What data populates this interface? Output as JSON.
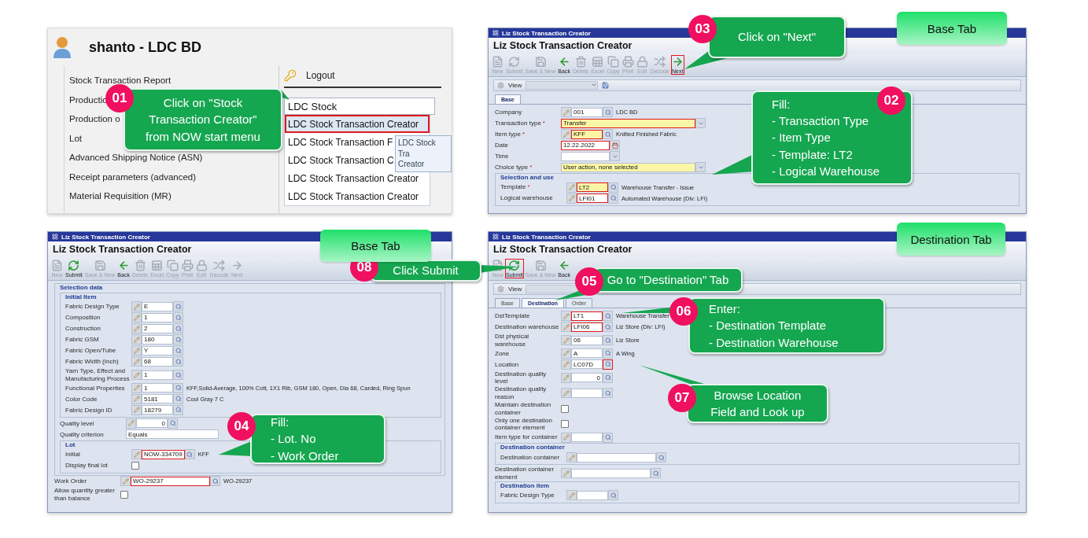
{
  "panels": [
    {
      "kind": "portal",
      "user": "shanto - LDC BD",
      "menu": [
        "Stock Transaction Report",
        "Productio",
        "Production o",
        "Lot",
        "Advanced Shipping Notice (ASN)",
        "Receipt parameters (advanced)",
        "Material Requisition (MR)"
      ],
      "logout": "Logout",
      "search": {
        "value": "LDC Stock"
      },
      "results": [
        {
          "label": "LDC Stock Transaction Creator",
          "selected": true
        },
        {
          "label": "LDC Stock Transaction F",
          "selected": false
        },
        {
          "label": "LDC Stock Transaction C",
          "selected": false
        },
        {
          "label": "LDC Stock Transaction Creator",
          "selected": false
        },
        {
          "label": "LDC Stock Transaction Creator",
          "selected": false
        }
      ],
      "tooltip": "LDC Stock Tra\nCreator"
    },
    {
      "kind": "form",
      "window_title": "Liz Stock Transaction Creator",
      "heading": "Liz Stock Transaction Creator",
      "toolbar": [
        {
          "label": "New",
          "enabled": false,
          "highlighted": false
        },
        {
          "label": "Submit",
          "enabled": false,
          "highlighted": false
        },
        {
          "label": "Save & New",
          "enabled": false,
          "highlighted": false
        },
        {
          "label": "Back",
          "enabled": true,
          "highlighted": false
        },
        {
          "label": "Delete",
          "enabled": false,
          "highlighted": false
        },
        {
          "label": "Excel",
          "enabled": false,
          "highlighted": false
        },
        {
          "label": "Copy",
          "enabled": false,
          "highlighted": false
        },
        {
          "label": "Print",
          "enabled": false,
          "highlighted": false
        },
        {
          "label": "Edit",
          "enabled": false,
          "highlighted": false
        },
        {
          "label": "Decode",
          "enabled": false,
          "highlighted": false
        },
        {
          "label": "Next",
          "enabled": true,
          "highlighted": true
        }
      ],
      "view": "View",
      "save_visible": true,
      "tabs": [
        {
          "label": "Base",
          "selected": true
        }
      ],
      "rows": [
        {
          "kind": "lookup",
          "label": "Company",
          "value": "001",
          "description": "LDC BD"
        },
        {
          "kind": "select",
          "label": "Transaction type",
          "mark": "*",
          "value": "Transfer",
          "highlighted": true
        },
        {
          "kind": "lookup",
          "label": "Item type",
          "mark": "*",
          "value": "KFF",
          "description": "Knitted Finished Fabric",
          "highlighted": true
        },
        {
          "kind": "date",
          "label": "Date",
          "value": "12.22.2022",
          "highlighted": true
        },
        {
          "kind": "select-short",
          "label": "Time"
        },
        {
          "kind": "select",
          "label": "Choice type",
          "mark": "*",
          "value": "User action, none selected"
        },
        {
          "kind": "group",
          "legend": "Selection and use",
          "rows": [
            {
              "kind": "lookup",
              "label": "Template",
              "mark": "*",
              "value": "LT2",
              "description": "Warehouse Transfer - Issue",
              "highlighted": true
            },
            {
              "kind": "lookup",
              "label": "Logical warehouse",
              "value": "LFI01",
              "description": "Automated Warehouse (Div: LFI)",
              "highlighted": true
            }
          ]
        }
      ]
    },
    {
      "kind": "form",
      "window_title": "Liz Stock Transaction Creator",
      "heading": "Liz Stock Transaction Creator",
      "toolbar": [
        {
          "label": "New",
          "enabled": false,
          "highlighted": false
        },
        {
          "label": "Submit",
          "enabled": true,
          "highlighted": false
        },
        {
          "label": "Save & New",
          "enabled": false,
          "highlighted": false
        },
        {
          "label": "Back",
          "enabled": true,
          "highlighted": false
        },
        {
          "label": "Delete",
          "enabled": false,
          "highlighted": false
        },
        {
          "label": "Excel",
          "enabled": false,
          "highlighted": false
        },
        {
          "label": "Copy",
          "enabled": false,
          "highlighted": false
        },
        {
          "label": "Print",
          "enabled": false,
          "highlighted": false
        },
        {
          "label": "Edit",
          "enabled": false,
          "highlighted": false
        },
        {
          "label": "Decode",
          "enabled": false,
          "highlighted": false
        },
        {
          "label": "Next",
          "enabled": false,
          "highlighted": false
        }
      ],
      "rows": [
        {
          "kind": "group",
          "legend": "Selection data",
          "rows": [
            {
              "kind": "group",
              "legend": "Initial Item",
              "rows": [
                {
                  "kind": "lookup",
                  "label": "Fabric Design Type",
                  "value": "E"
                },
                {
                  "kind": "lookup",
                  "label": "Composition",
                  "value": "1"
                },
                {
                  "kind": "lookup",
                  "label": "Construction",
                  "value": "2"
                },
                {
                  "kind": "lookup",
                  "label": "Fabric GSM",
                  "value": "180"
                },
                {
                  "kind": "lookup",
                  "label": "Fabric Open/Tube",
                  "value": "Y"
                },
                {
                  "kind": "lookup",
                  "label": "Fabric Width (Inch)",
                  "value": "68"
                },
                {
                  "kind": "lookup",
                  "label": "Yarn Type, Effect and Manufacturing Process",
                  "value": "1"
                },
                {
                  "kind": "lookup",
                  "label": "Functional Properties",
                  "value": "1",
                  "description": "KFF,Solid-Average, 100% Cott, 1X1 Rib, GSM 180, Open, Dia 68, Carded, Ring Spun"
                },
                {
                  "kind": "lookup",
                  "label": "Color Code",
                  "value": "5181",
                  "description": "Cool Gray 7 C"
                },
                {
                  "kind": "lookup",
                  "label": "Fabric Design ID",
                  "value": "18279"
                }
              ]
            },
            {
              "kind": "number",
              "label": "Quality level",
              "value": "0"
            },
            {
              "kind": "text",
              "label": "Quality criterion",
              "value": "Equals"
            },
            {
              "kind": "group",
              "legend": "Lot",
              "rows": [
                {
                  "kind": "lookup",
                  "label": "Initial",
                  "value": "NOW-334709",
                  "description": "KFF",
                  "highlighted": true
                },
                {
                  "kind": "checkbox",
                  "label": "Display final lot",
                  "checked": false
                }
              ]
            }
          ]
        },
        {
          "kind": "lookup-wide",
          "label": "Work Order",
          "value": "WO-29237",
          "description": "WO-29237",
          "highlighted": true
        },
        {
          "kind": "checkbox",
          "label": "Allow quantity greater than balance",
          "checked": false
        }
      ]
    },
    {
      "kind": "form",
      "window_title": "Liz Stock Transaction Creator",
      "heading": "Liz Stock Transaction Creator",
      "toolbar": [
        {
          "label": "New",
          "enabled": false,
          "highlighted": false
        },
        {
          "label": "Submit",
          "enabled": true,
          "highlighted": true
        },
        {
          "label": "Save & New",
          "enabled": false,
          "highlighted": false
        },
        {
          "label": "Back",
          "enabled": true,
          "highlighted": false
        }
      ],
      "view": "View",
      "tabs": [
        {
          "label": "Base",
          "selected": false
        },
        {
          "label": "Destination",
          "selected": true
        },
        {
          "label": "Order",
          "selected": false
        }
      ],
      "rows": [
        {
          "kind": "lookup",
          "label": "DstTemplate",
          "value": "LT1",
          "description": "Warehouse Transfer",
          "highlighted": true
        },
        {
          "kind": "lookup",
          "label": "Destination warehouse",
          "value": "LFI06",
          "description": "Liz Store (Div: LFI)",
          "highlighted": true
        },
        {
          "kind": "lookup",
          "label": "Dst physical warehouse",
          "value": "06",
          "description": "Liz Store"
        },
        {
          "kind": "lookup",
          "label": "Zone",
          "value": "A",
          "description": "A Wing"
        },
        {
          "kind": "lookup",
          "label": "Location",
          "value": "LC07D",
          "lookup_highlighted": true
        },
        {
          "kind": "number",
          "label": "Destination quality level",
          "value": "0"
        },
        {
          "kind": "lookup",
          "label": "Destination quality reason"
        },
        {
          "kind": "checkbox",
          "label": "Maintain destination container",
          "checked": false
        },
        {
          "kind": "checkbox",
          "label": "Only one destination container element",
          "checked": false
        },
        {
          "kind": "lookup",
          "label": "Item type for container"
        },
        {
          "kind": "group",
          "legend": "Destination container",
          "rows": [
            {
              "kind": "lookup-wide",
              "label": "Destination container"
            }
          ]
        },
        {
          "kind": "lookup-wide",
          "label": "Destination container element"
        },
        {
          "kind": "group",
          "legend": "Destination item",
          "rows": [
            {
              "kind": "lookup",
              "label": "Fabric Design Type"
            }
          ]
        }
      ]
    }
  ],
  "callouts": [
    {
      "number": "01",
      "text": "Click on \"Stock\nTransaction Creator\"\nfrom NOW start menu"
    },
    {
      "number": "02",
      "text": "Fill:\n- Transaction Type\n- Item Type\n- Template: LT2\n- Logical Warehouse"
    },
    {
      "number": "03",
      "text": "Click on \"Next\""
    },
    {
      "number": "04",
      "text": "Fill:\n- Lot. No\n- Work Order"
    },
    {
      "number": "05",
      "text": "Go to \"Destination\" Tab"
    },
    {
      "number": "06",
      "text": "Enter:\n- Destination Template\n- Destination Warehouse"
    },
    {
      "number": "07",
      "text": "Browse Location\nField and Look up"
    },
    {
      "number": "08",
      "text": "Click Submit"
    }
  ],
  "tab_labels": [
    "Base Tab",
    "Base Tab",
    "Destination Tab"
  ]
}
